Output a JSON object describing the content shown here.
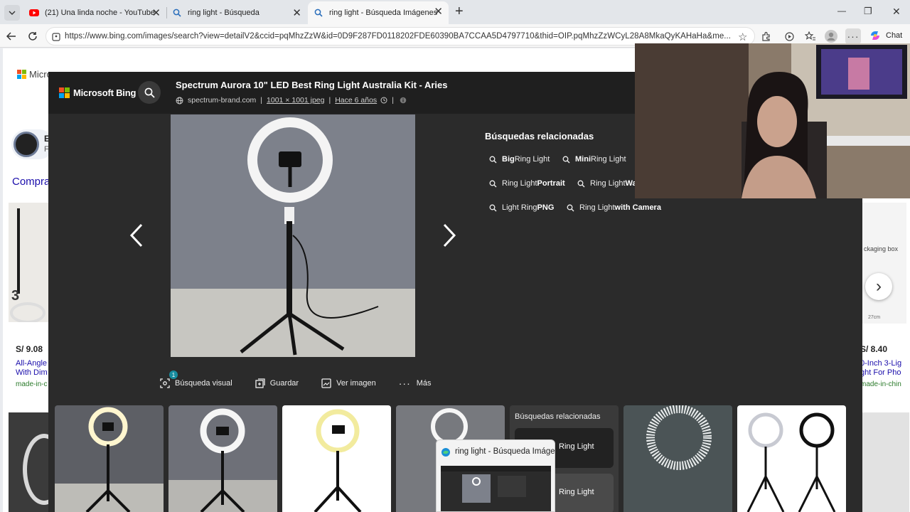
{
  "tabs": [
    {
      "title": "(21) Una linda noche - YouTube",
      "close": "✕"
    },
    {
      "title": "ring light - Búsqueda",
      "close": "✕"
    },
    {
      "title": "ring light - Búsqueda Imágenes",
      "close": "✕"
    }
  ],
  "new_tab": "+",
  "window_controls": {
    "minimize": "—",
    "maximize": "❐",
    "close": "✕"
  },
  "address": {
    "url": "https://www.bing.com/images/search?view=detailV2&ccid=pqMhzZzW&id=0D9F287FD0118202FDE60390BA7CCAA5D4797710&thid=OIP.pqMhzZzWCyL28A8MkaQyKAHaHa&me..."
  },
  "toolbar": {
    "chat_label": "Chat"
  },
  "background_page": {
    "logo_text": "Micro",
    "shop_heading": "Compra",
    "prices": [
      "S/ 9.08",
      "S/ 8.40"
    ],
    "left_caption": [
      "All-Angle",
      "With Dim",
      "made-in-c"
    ],
    "right_caption": [
      "0-Inch 3-Lig",
      "ght For Pho",
      "made-in-chin"
    ],
    "packaging_label": "ckaging box",
    "dim_label": "27cm",
    "left_profile": [
      "E",
      "F"
    ],
    "carousel_next": "›"
  },
  "overlay": {
    "brand": "Microsoft Bing",
    "title": "Spectrum Aurora 10\" LED Best Ring Light Australia Kit - Aries",
    "source": "spectrum-brand.com",
    "size": "1001 × 1001 jpeg",
    "age": "Hace 6 años",
    "actions": {
      "visual_search": "Búsqueda visual",
      "save": "Guardar",
      "view_image": "Ver imagen",
      "more": "Más"
    },
    "badge_count": "1",
    "related_heading": "Búsquedas relacionadas",
    "related": [
      {
        "bold": "Big",
        "text": " Ring Light"
      },
      {
        "bold": "Mini",
        "text": " Ring Light"
      },
      {
        "pre": "Ring Light ",
        "bold": "Portrait"
      },
      {
        "pre": "Ring Light ",
        "bold": "Wa"
      },
      {
        "pre": "Light Ring ",
        "bold": "PNG"
      },
      {
        "pre": "Ring Light ",
        "bold": "with Camera"
      }
    ],
    "thumb_related_heading": "Búsquedas relacionadas",
    "thumb_related_items": [
      "Ring Light",
      "Ring Light"
    ]
  },
  "preview": {
    "title": "ring light - Búsqueda Imágenes"
  },
  "colors": {
    "overlay_bg": "#2b2b2b",
    "header_bg": "#1f1f1f",
    "accent": "#178c9f"
  }
}
